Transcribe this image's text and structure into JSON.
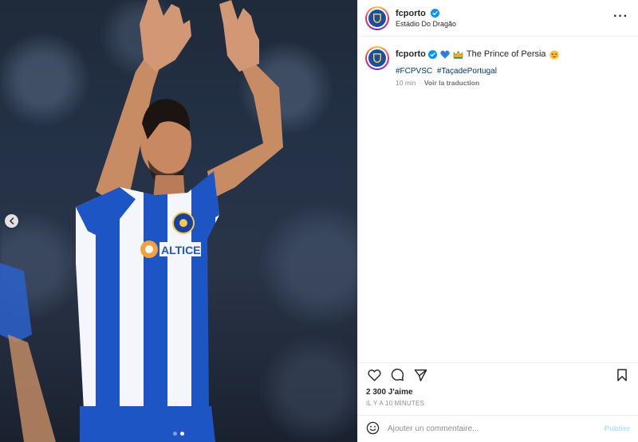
{
  "post": {
    "username": "fcporto",
    "location": "Estádio Do Dragão",
    "verified": true
  },
  "caption": {
    "username": "fcporto",
    "emojis": [
      "blue-heart-emoji",
      "crown-emoji"
    ],
    "text": "The Prince of Persia",
    "trailing_emoji": "star-struck-emoji",
    "hashtags": [
      "#FCPVSC",
      "#TaçadePortugal"
    ],
    "time": "10 min",
    "see_translation": "Voir la traduction"
  },
  "media": {
    "sponsor_text": "ALTICE",
    "carousel_dots": 2,
    "active_dot": 1
  },
  "stats": {
    "likes": "2 300 J'aime",
    "time_ago": "IL Y A 10 MINUTES"
  },
  "comment": {
    "placeholder": "Ajouter un commentaire...",
    "publish_label": "Publier"
  },
  "colors": {
    "accent_blue": "#0095f6",
    "link_blue": "#00376b",
    "porto_blue": "#1a4fa0"
  }
}
